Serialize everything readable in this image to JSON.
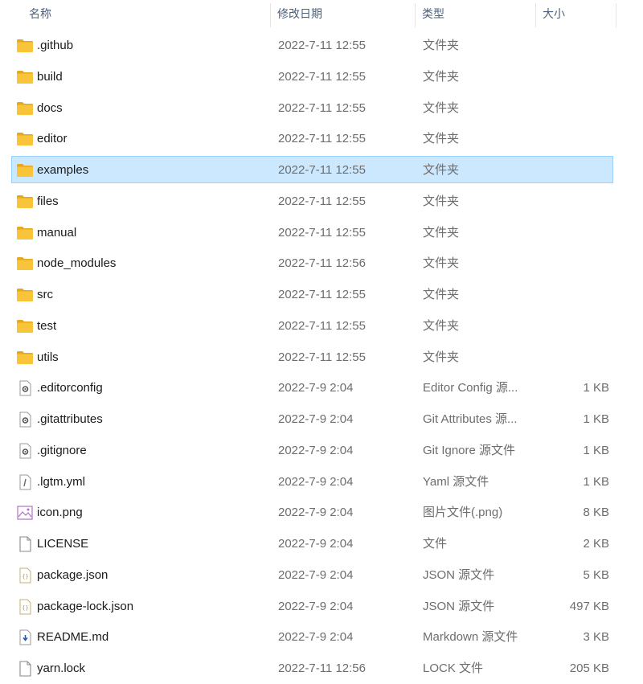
{
  "columns": {
    "name": "名称",
    "date": "修改日期",
    "type": "类型",
    "size": "大小"
  },
  "colors": {
    "folder": "#f8c43a",
    "folder_dark": "#e7a91b",
    "selected_bg": "#cce8ff",
    "selected_border": "#99d1ff",
    "header_text": "#4c607a",
    "secondary_text": "#6d6d6d"
  },
  "rows": [
    {
      "icon": "folder-icon",
      "name": ".github",
      "date": "2022-7-11 12:55",
      "type": "文件夹",
      "size": "",
      "selected": false
    },
    {
      "icon": "folder-icon",
      "name": "build",
      "date": "2022-7-11 12:55",
      "type": "文件夹",
      "size": "",
      "selected": false
    },
    {
      "icon": "folder-icon",
      "name": "docs",
      "date": "2022-7-11 12:55",
      "type": "文件夹",
      "size": "",
      "selected": false
    },
    {
      "icon": "folder-icon",
      "name": "editor",
      "date": "2022-7-11 12:55",
      "type": "文件夹",
      "size": "",
      "selected": false
    },
    {
      "icon": "folder-icon",
      "name": "examples",
      "date": "2022-7-11 12:55",
      "type": "文件夹",
      "size": "",
      "selected": true
    },
    {
      "icon": "folder-icon",
      "name": "files",
      "date": "2022-7-11 12:55",
      "type": "文件夹",
      "size": "",
      "selected": false
    },
    {
      "icon": "folder-icon",
      "name": "manual",
      "date": "2022-7-11 12:55",
      "type": "文件夹",
      "size": "",
      "selected": false
    },
    {
      "icon": "folder-icon",
      "name": "node_modules",
      "date": "2022-7-11 12:56",
      "type": "文件夹",
      "size": "",
      "selected": false
    },
    {
      "icon": "folder-icon",
      "name": "src",
      "date": "2022-7-11 12:55",
      "type": "文件夹",
      "size": "",
      "selected": false
    },
    {
      "icon": "folder-icon",
      "name": "test",
      "date": "2022-7-11 12:55",
      "type": "文件夹",
      "size": "",
      "selected": false
    },
    {
      "icon": "folder-icon",
      "name": "utils",
      "date": "2022-7-11 12:55",
      "type": "文件夹",
      "size": "",
      "selected": false
    },
    {
      "icon": "config-file-icon",
      "name": ".editorconfig",
      "date": "2022-7-9 2:04",
      "type": "Editor Config 源...",
      "size": "1 KB",
      "selected": false
    },
    {
      "icon": "config-file-icon",
      "name": ".gitattributes",
      "date": "2022-7-9 2:04",
      "type": "Git Attributes 源...",
      "size": "1 KB",
      "selected": false
    },
    {
      "icon": "config-file-icon",
      "name": ".gitignore",
      "date": "2022-7-9 2:04",
      "type": "Git Ignore 源文件",
      "size": "1 KB",
      "selected": false
    },
    {
      "icon": "yaml-file-icon",
      "name": ".lgtm.yml",
      "date": "2022-7-9 2:04",
      "type": "Yaml 源文件",
      "size": "1 KB",
      "selected": false
    },
    {
      "icon": "image-file-icon",
      "name": "icon.png",
      "date": "2022-7-9 2:04",
      "type": "图片文件(.png)",
      "size": "8 KB",
      "selected": false
    },
    {
      "icon": "blank-file-icon",
      "name": "LICENSE",
      "date": "2022-7-9 2:04",
      "type": "文件",
      "size": "2 KB",
      "selected": false
    },
    {
      "icon": "json-file-icon",
      "name": "package.json",
      "date": "2022-7-9 2:04",
      "type": "JSON 源文件",
      "size": "5 KB",
      "selected": false
    },
    {
      "icon": "json-file-icon",
      "name": "package-lock.json",
      "date": "2022-7-9 2:04",
      "type": "JSON 源文件",
      "size": "497 KB",
      "selected": false
    },
    {
      "icon": "markdown-file-icon",
      "name": "README.md",
      "date": "2022-7-9 2:04",
      "type": "Markdown 源文件",
      "size": "3 KB",
      "selected": false
    },
    {
      "icon": "blank-file-icon",
      "name": "yarn.lock",
      "date": "2022-7-11 12:56",
      "type": "LOCK 文件",
      "size": "205 KB",
      "selected": false
    }
  ]
}
